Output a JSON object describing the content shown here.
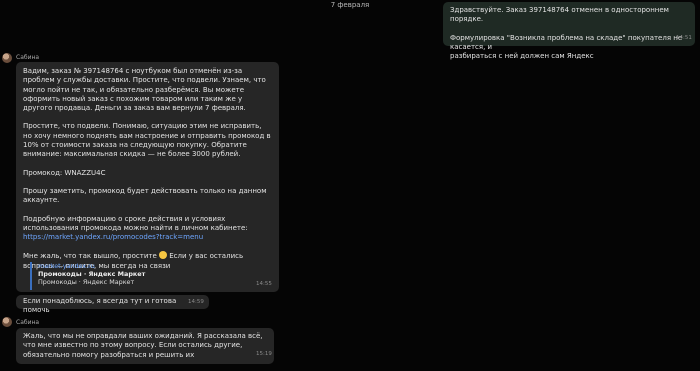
{
  "date_separator": "7 февраля",
  "messages": {
    "outgoing": {
      "line1": "Здравствуйте. Заказ 397148764 отменен в одностороннем порядке.",
      "line2": "Формулировка \"Возникла проблема на складе\" покупателя не касается, и",
      "line3": "разбираться с ней должен сам Яндекс",
      "time": "14:51"
    },
    "group1": {
      "sender": "Сабина",
      "p1": "Вадим, заказ № 397148764 с ноутбуком был отменён из-за проблем у службы доставки.  Простите, что подвели. Узнаем, что могло пойти не так, и обязательно разберёмся.  Вы можете оформить новый заказ с похожим товаром или таким же у другого продавца. Деньги за заказ вам вернули 7 февраля.",
      "p2": "Простите, что подвели. Понимаю, ситуацию этим не исправить, но хочу немного поднять вам настроение и отправить промокод в 10% от стоимости заказа на следующую покупку. Обратите внимание: максимальная скидка — не более 3000 рублей.",
      "p3": "Промокод: WNAZZU4C",
      "p4": "Прошу заметить, промокод будет действовать только на данном аккаунте.",
      "p5_text": "Подробную информацию о сроке действия и условиях использования промокода можно найти в личном кабинете: ",
      "p5_link": "https://market.yandex.ru/promocodes?track=menu",
      "p6a": "Мне жаль, что так вышло, простите ",
      "p6b": " Если у вас остались вопросы — пишите, мы всегда на связи",
      "preview_site": "market.yandex.ru",
      "preview_title": "Промокоды · Яндекс Маркет",
      "preview_desc": "Промокоды · Яндекс Маркет",
      "time": "14:55",
      "followup": "Если понадоблюсь, я всегда тут и готова помочь",
      "followup_time": "14:59"
    },
    "group2": {
      "sender": "Сабина",
      "text": "Жаль, что мы не оправдали ваших ожиданий. Я рассказала всё, что мне известно по этому вопросу. Если остались другие, обязательно помогу разобраться и решить их",
      "time": "15:19"
    }
  },
  "colors": {
    "background": "#050505",
    "incoming_bubble": "#262626",
    "outgoing_bubble": "#1f2a24",
    "link": "#6ea6ff"
  }
}
